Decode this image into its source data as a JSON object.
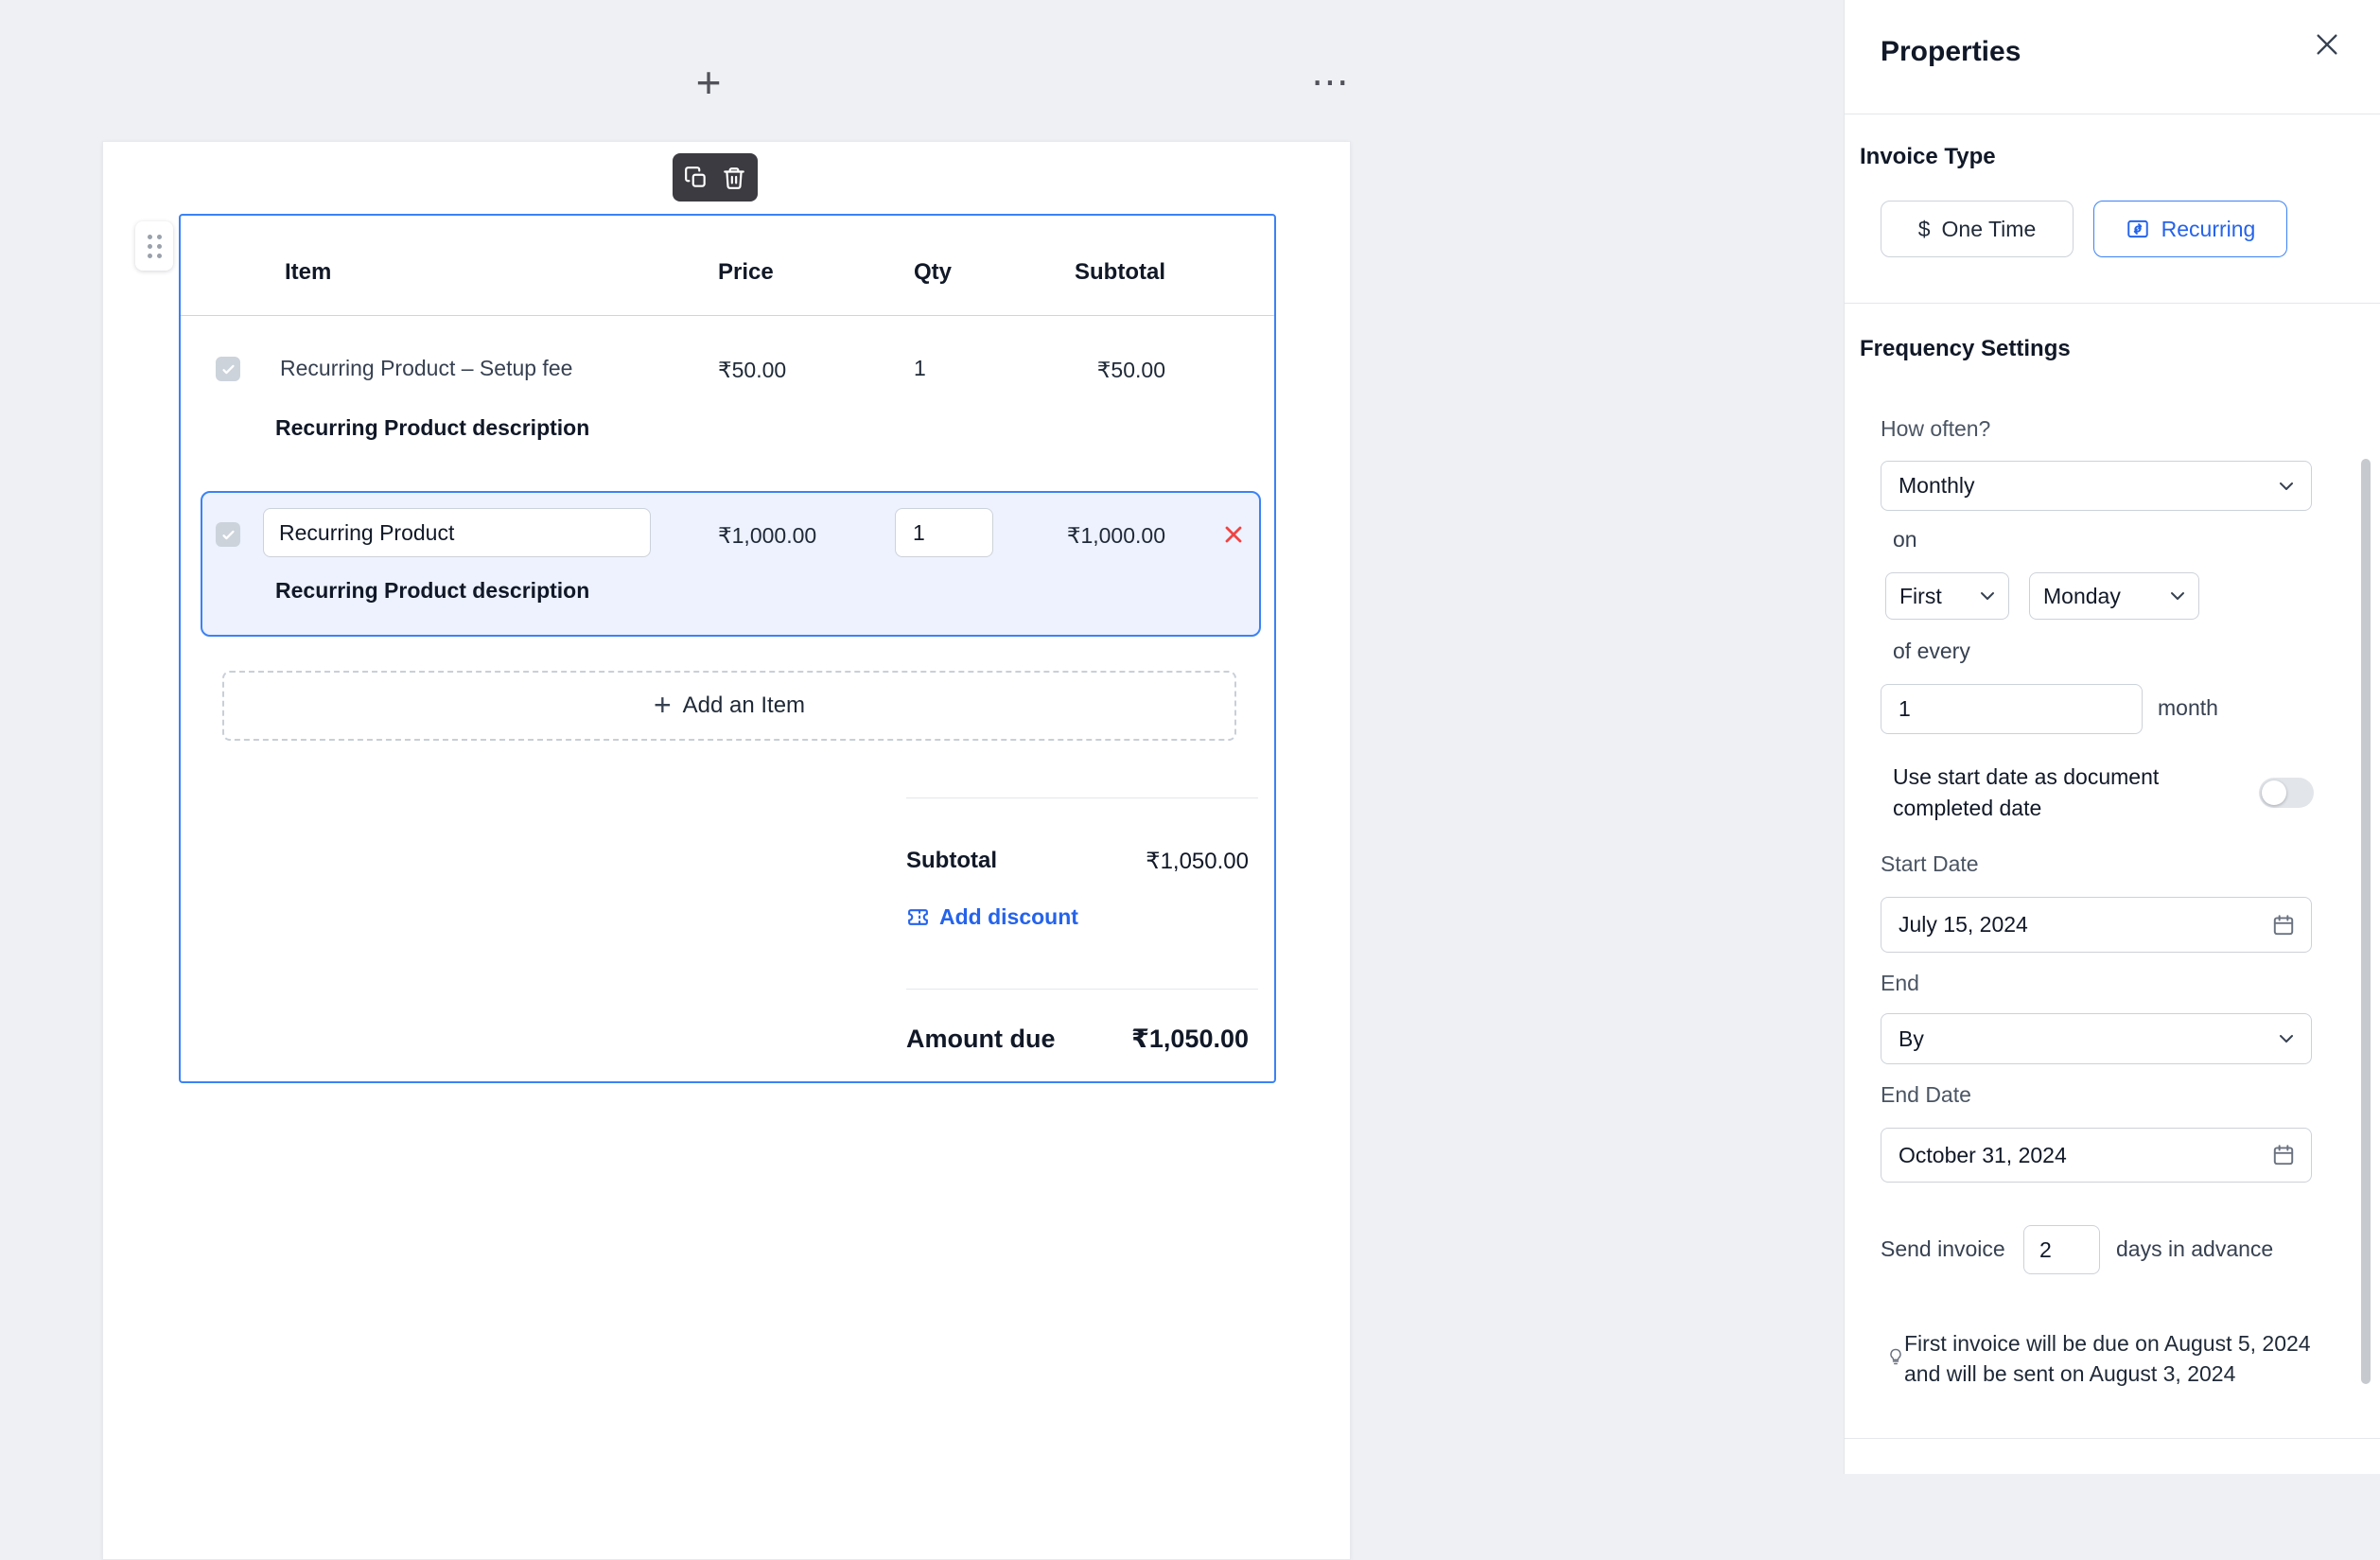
{
  "theme": {
    "accent_blue": "#2563eb",
    "selection_blue": "#3b82f6",
    "danger_red": "#ef4444",
    "canvas_bg": "#eef0f3"
  },
  "canvas": {
    "add_block_icon": "+",
    "more_icon": "⋯"
  },
  "invoice": {
    "headers": {
      "item": "Item",
      "price": "Price",
      "qty": "Qty",
      "subtotal": "Subtotal"
    },
    "rows": [
      {
        "name": "Recurring Product – Setup fee",
        "price": "₹50.00",
        "qty": "1",
        "subtotal": "₹50.00",
        "description": "Recurring Product description"
      },
      {
        "name": "Recurring Product",
        "price": "₹1,000.00",
        "qty": "1",
        "subtotal": "₹1,000.00",
        "description": "Recurring Product description"
      }
    ],
    "add_item_label": "Add an Item",
    "totals": {
      "subtotal_label": "Subtotal",
      "subtotal_value": "₹1,050.00",
      "add_discount_label": "Add discount",
      "amount_due_label": "Amount due",
      "amount_due_value": "₹1,050.00"
    }
  },
  "properties": {
    "title": "Properties",
    "invoice_type": {
      "label": "Invoice Type",
      "one_time_icon": "$",
      "one_time_label": "One Time",
      "recurring_label": "Recurring",
      "selected": "Recurring"
    },
    "frequency": {
      "label": "Frequency Settings",
      "how_often_label": "How often?",
      "how_often_value": "Monthly",
      "on_label": "on",
      "week_ordinal_value": "First",
      "weekday_value": "Monday",
      "of_every_label": "of every",
      "interval_value": "1",
      "interval_unit_label": "month",
      "use_start_date_label": "Use start date as document completed date",
      "use_start_date_enabled": false,
      "start_date_label": "Start Date",
      "start_date_value": "July 15, 2024",
      "end_label": "End",
      "end_value": "By",
      "end_date_label": "End Date",
      "end_date_value": "October 31, 2024",
      "send_invoice_label": "Send invoice",
      "send_days_value": "2",
      "days_in_advance_label": "days in advance",
      "note": "First invoice will be due on August 5, 2024 and will be sent on August 3, 2024"
    }
  }
}
